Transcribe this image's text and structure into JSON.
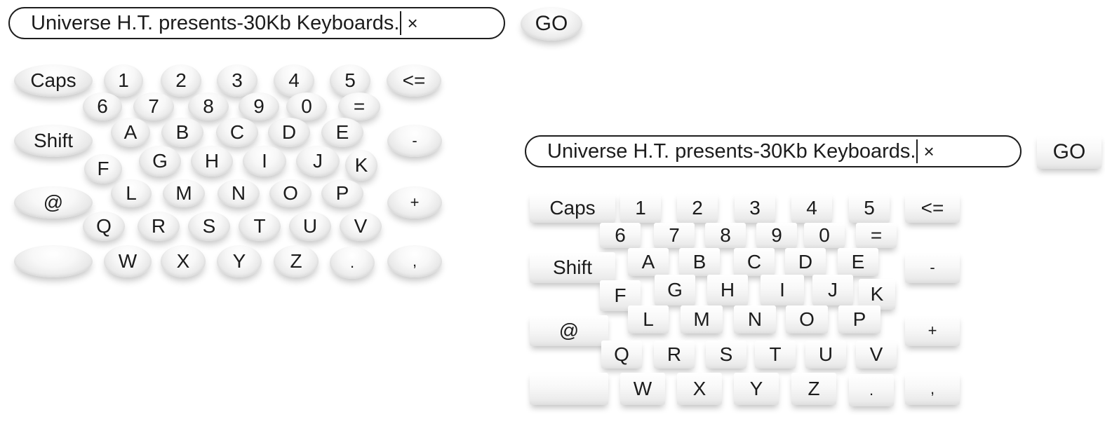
{
  "search": {
    "text": "Universe H.T. presents-30Kb Keyboards.",
    "clear_symbol": "×",
    "go_label": "GO"
  },
  "keys": {
    "caps": "Caps",
    "shift": "Shift",
    "at": "@",
    "space": "",
    "backspace": "<=",
    "minus": "-",
    "plus": "+",
    "period": ".",
    "comma": ",",
    "equals": "=",
    "d1": "1",
    "d2": "2",
    "d3": "3",
    "d4": "4",
    "d5": "5",
    "d6": "6",
    "d7": "7",
    "d8": "8",
    "d9": "9",
    "d0": "0",
    "a": "A",
    "b": "B",
    "c": "C",
    "d": "D",
    "e": "E",
    "f": "F",
    "g": "G",
    "h": "H",
    "i": "I",
    "j": "J",
    "k": "K",
    "l": "L",
    "m": "M",
    "n": "N",
    "o": "O",
    "p": "P",
    "q": "Q",
    "r": "R",
    "s": "S",
    "t": "T",
    "u": "U",
    "v": "V",
    "w": "W",
    "x": "X",
    "y": "Y",
    "z": "Z"
  }
}
